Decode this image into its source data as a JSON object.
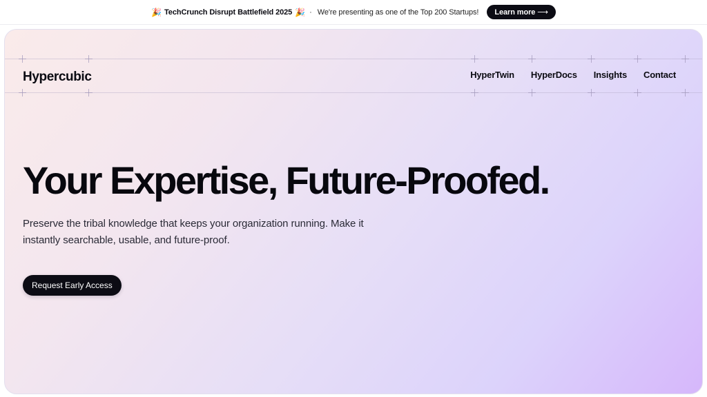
{
  "announcement": {
    "emoji_left": "🎉",
    "headline": "TechCrunch Disrupt Battlefield 2025",
    "emoji_right": "🎉",
    "separator": "·",
    "message": "We're presenting as one of the Top 200 Startups!",
    "button_label": "Learn more",
    "button_arrow": "⟶"
  },
  "nav": {
    "logo": "Hypercubic",
    "items": [
      {
        "label": "HyperTwin"
      },
      {
        "label": "HyperDocs"
      },
      {
        "label": "Insights"
      },
      {
        "label": "Contact"
      }
    ]
  },
  "hero": {
    "title": "Your Expertise, Future-Proofed.",
    "subtitle": "Preserve the tribal knowledge that keeps your organization running. Make it instantly searchable, usable, and future-proof.",
    "cta_label": "Request Early Access"
  },
  "colors": {
    "button_bg": "#0c0c14",
    "gradient_start": "#faebea",
    "gradient_mid": "#e6def7",
    "gradient_end": "#d6b7fb"
  }
}
